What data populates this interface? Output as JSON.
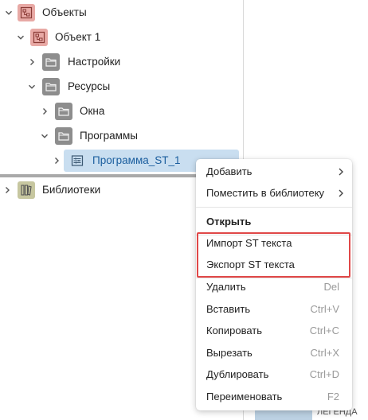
{
  "tree": {
    "root": {
      "label": "Объекты",
      "icon": "hierarchy-icon"
    },
    "object1": {
      "label": "Объект 1",
      "icon": "hierarchy-icon"
    },
    "settings": {
      "label": "Настройки",
      "icon": "folder-icon"
    },
    "resources": {
      "label": "Ресурсы",
      "icon": "folder-icon"
    },
    "windows": {
      "label": "Окна",
      "icon": "folder-icon"
    },
    "programs": {
      "label": "Программы",
      "icon": "folder-icon"
    },
    "program_st1": {
      "label": "Программа_ST_1",
      "icon": "program-flow-icon"
    }
  },
  "lower_tree": {
    "libraries": {
      "label": "Библиотеки",
      "icon": "library-icon"
    }
  },
  "context_menu": {
    "items": [
      {
        "label": "Добавить",
        "submenu": true
      },
      {
        "label": "Поместить в библиотеку",
        "submenu": true
      },
      {
        "label": "Открыть",
        "bold": true
      },
      {
        "label": "Импорт ST текста"
      },
      {
        "label": "Экспорт ST текста"
      },
      {
        "label": "Удалить",
        "shortcut": "Del"
      },
      {
        "label": "Вставить",
        "shortcut": "Ctrl+V"
      },
      {
        "label": "Копировать",
        "shortcut": "Ctrl+C"
      },
      {
        "label": "Вырезать",
        "shortcut": "Ctrl+X"
      },
      {
        "label": "Дублировать",
        "shortcut": "Ctrl+D"
      },
      {
        "label": "Переименовать",
        "shortcut": "F2"
      }
    ]
  },
  "bottom_tabs": {
    "tab2": "ЛЕГЕНДА"
  },
  "colors": {
    "selection": "#c9def0",
    "highlight_box": "#e04848",
    "object_icon_bg": "#e8a9a5",
    "folder_icon_bg": "#8d8d8d",
    "library_icon_bg": "#c7c7a0"
  }
}
